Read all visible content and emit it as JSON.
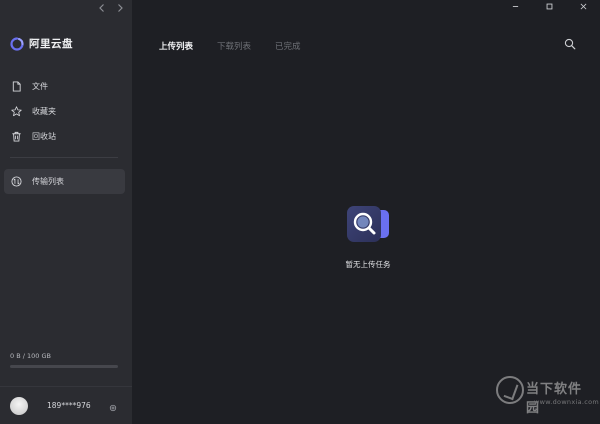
{
  "app": {
    "name": "阿里云盘",
    "accent_color": "#6a70f0",
    "logo_icon": "cloud-ring-icon"
  },
  "sidebar": {
    "nav_back_icon": "chevron-left-icon",
    "nav_forward_icon": "chevron-right-icon",
    "items": [
      {
        "label": "文件",
        "icon": "file-icon"
      },
      {
        "label": "收藏夹",
        "icon": "star-icon"
      },
      {
        "label": "回收站",
        "icon": "trash-icon"
      }
    ],
    "active_item": {
      "label": "传输列表",
      "icon": "transfer-icon"
    },
    "storage": {
      "text": "0 B / 100 GB",
      "used_fraction": 0
    },
    "user": {
      "name": "189****976",
      "settings_icon": "gear-icon"
    }
  },
  "window": {
    "controls": [
      "minimize-icon",
      "maximize-icon",
      "close-icon"
    ]
  },
  "main": {
    "tabs": [
      {
        "label": "上传列表",
        "active": true
      },
      {
        "label": "下载列表",
        "active": false
      },
      {
        "label": "已完成",
        "active": false
      }
    ],
    "search_icon": "search-icon",
    "empty_state": {
      "text": "暂无上传任务",
      "icon": "magnifier-folder-icon"
    }
  },
  "watermark": {
    "title": "当下软件园",
    "url": "www.downxia.com"
  }
}
